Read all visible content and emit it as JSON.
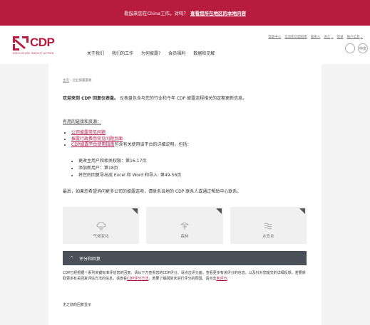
{
  "banner": {
    "text": "看起来您在China工作。对吗？",
    "link": "查看您所在地区的本地内容"
  },
  "header": {
    "logo": {
      "name": "CDP",
      "tagline": "DISCLOSURE INSIGHT ACTION"
    },
    "util_links": [
      "帮助中心",
      "信息和页面指南",
      "联系人",
      "语言",
      "登录",
      "账户信息"
    ],
    "nav": [
      "关于我们",
      "我们的工作",
      "为何披露?",
      "会员福利",
      "数据和见解"
    ],
    "circle_buttons": [
      "",
      "中文"
    ]
  },
  "breadcrumb": {
    "home": "主页",
    "separator": "›",
    "current": "企业披露面板"
  },
  "welcome": {
    "bold": "欢迎来到 CDP 回复仪表盘。",
    "rest": "仪表盘包含与您的行业和今年 CDP 披露流程相关的定期更新信息。"
  },
  "useful_links_heading": "有用的链接和资源：",
  "links": [
    {
      "link": "公司披露常见问题",
      "suffix": ""
    },
    {
      "link": "披露行政费用常见问题页面",
      "suffix": ""
    },
    {
      "link": "CDP披露平台使用指南",
      "suffix": "包含有关使用该平台的详细说明，包括："
    }
  ],
  "sub_items": [
    "更改主用户和相关权限：第16-17页",
    "添加新用户：第18页",
    "将您的回复导出成 Excel 和 Word 和导入: 第49-56页"
  ],
  "final_note": "最后，如果您希望询问更多公司的披露选项，请联系当地的 CDP 联系人或通过帮助中心联系。",
  "topics": [
    {
      "label": "气候变化",
      "icon": "cloud-icon"
    },
    {
      "label": "森林",
      "icon": "tree-icon"
    },
    {
      "label": "水安全",
      "icon": "water-icon"
    }
  ],
  "accordion": {
    "title": "评分和回复",
    "body_pre": "CDP已经根据一系列关键标准评估您的回复。请从下方查看您的CDP评分。请点击评分面，查看更多有关评分的信息，以及针对您提交的详细反馈。若要获取更多有关回复评估方法的信息，请查看",
    "body_link1": "CDP评分方法",
    "body_mid": "。若要了解回复未进行评分的原因，请点击",
    "body_link2": "未评分",
    "body_post": "。",
    "none": "无之前的回复显示"
  },
  "colors": {
    "brand": "#b71c3f",
    "link": "#b0154b",
    "accordion_bg": "#4a5058"
  }
}
